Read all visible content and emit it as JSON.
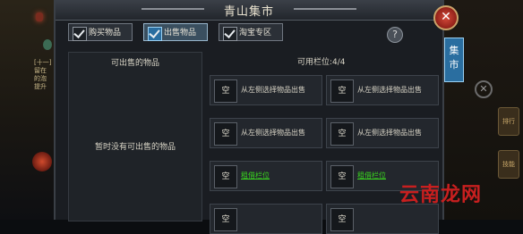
{
  "title": "青山集市",
  "tabs": [
    {
      "label": "购买物品",
      "active": false
    },
    {
      "label": "出售物品",
      "active": true
    },
    {
      "label": "淘宝专区",
      "active": false
    }
  ],
  "left_panel": {
    "header": "可出售的物品",
    "empty_text": "暂时没有可出售的物品"
  },
  "available_slots": "可用栏位:4/4",
  "slots": [
    {
      "box": "空",
      "text": "从左侧选择物品出售",
      "is_link": false
    },
    {
      "box": "空",
      "text": "从左侧选择物品出售",
      "is_link": false
    },
    {
      "box": "空",
      "text": "从左侧选择物品出售",
      "is_link": false
    },
    {
      "box": "空",
      "text": "从左侧选择物品出售",
      "is_link": false
    },
    {
      "box": "空",
      "text": "租借栏位",
      "is_link": true
    },
    {
      "box": "空",
      "text": "租借栏位",
      "is_link": true
    },
    {
      "box": "空",
      "text": "",
      "is_link": false
    },
    {
      "box": "空",
      "text": "",
      "is_link": false
    }
  ],
  "side_tab": "集市",
  "help": "?",
  "close": "✕",
  "watermark": "云南龙网",
  "colors": {
    "accent": "#2a6ea0",
    "link": "#39d21f",
    "close": "#c23a2c"
  }
}
